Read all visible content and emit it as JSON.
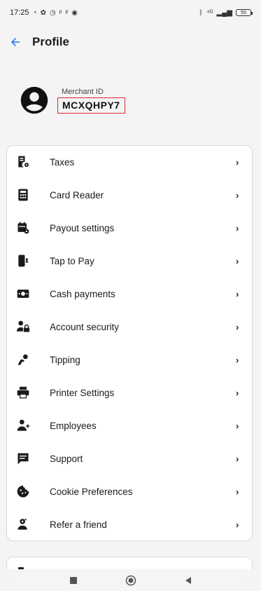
{
  "status_bar": {
    "time": "17:25",
    "left_icons": [
      "whatsapp-icon",
      "settings-icon",
      "alarm-icon",
      "app-icon",
      "app-icon",
      "cloud-icon"
    ],
    "right_icons": [
      "bluetooth-icon",
      "volte-icon",
      "signal-icon"
    ],
    "battery": "55"
  },
  "header": {
    "title": "Profile",
    "back_icon": "arrow-left-icon"
  },
  "merchant": {
    "label": "Merchant ID",
    "id": "MCXQHPY7",
    "highlight_color": "#e0242b"
  },
  "menu": {
    "items": [
      {
        "label": "Taxes",
        "icon": "receipt-settings-icon"
      },
      {
        "label": "Card Reader",
        "icon": "calculator-icon"
      },
      {
        "label": "Payout settings",
        "icon": "calendar-settings-icon"
      },
      {
        "label": "Tap to Pay",
        "icon": "tap-phone-icon"
      },
      {
        "label": "Cash payments",
        "icon": "cash-icon"
      },
      {
        "label": "Account security",
        "icon": "account-lock-icon"
      },
      {
        "label": "Tipping",
        "icon": "hand-coin-icon"
      },
      {
        "label": "Printer Settings",
        "icon": "printer-icon"
      },
      {
        "label": "Employees",
        "icon": "account-plus-icon"
      },
      {
        "label": "Support",
        "icon": "message-icon"
      },
      {
        "label": "Cookie Preferences",
        "icon": "cookie-icon"
      },
      {
        "label": "Refer a friend",
        "icon": "gift-person-icon"
      }
    ],
    "chevron": "›"
  },
  "nav_bar": {
    "buttons": [
      "recents-square-icon",
      "home-circle-icon",
      "back-triangle-icon"
    ]
  },
  "colors": {
    "accent": "#1a73e8",
    "background": "#f4f4f5",
    "card": "#ffffff"
  }
}
